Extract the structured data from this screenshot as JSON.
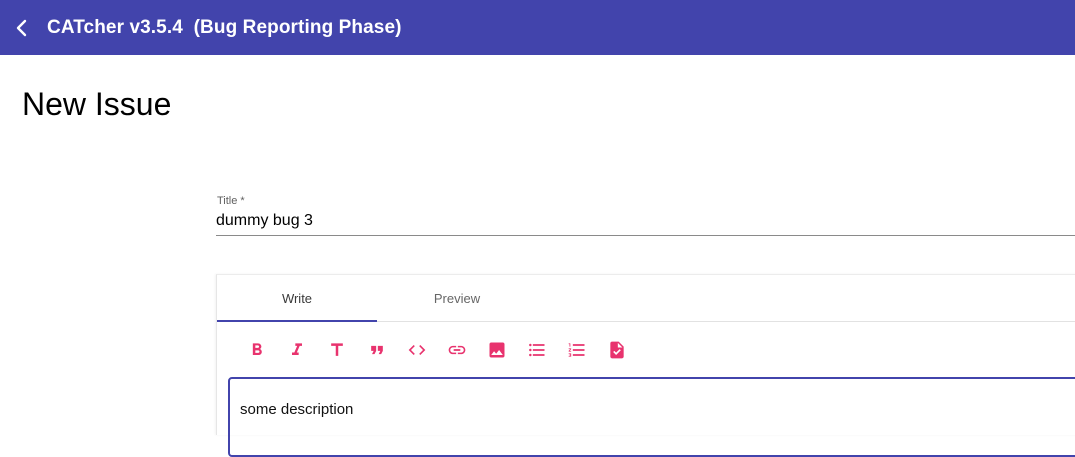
{
  "header": {
    "back_icon": "chevron-left-icon",
    "title": "CATcher v3.5.4  (Bug Reporting Phase)",
    "background_color": "#4244ac"
  },
  "page": {
    "title": "New Issue"
  },
  "form": {
    "title_label": "Title *",
    "title_value": "dummy bug 3"
  },
  "editor": {
    "tabs": [
      {
        "label": "Write",
        "active": true
      },
      {
        "label": "Preview",
        "active": false
      }
    ],
    "toolbar_icons": [
      "bold-icon",
      "italic-icon",
      "heading-icon",
      "quote-icon",
      "code-icon",
      "link-icon",
      "image-icon",
      "bulleted-list-icon",
      "numbered-list-icon",
      "task-list-icon"
    ],
    "accent_color": "#e8336e",
    "body_text": "some description"
  }
}
